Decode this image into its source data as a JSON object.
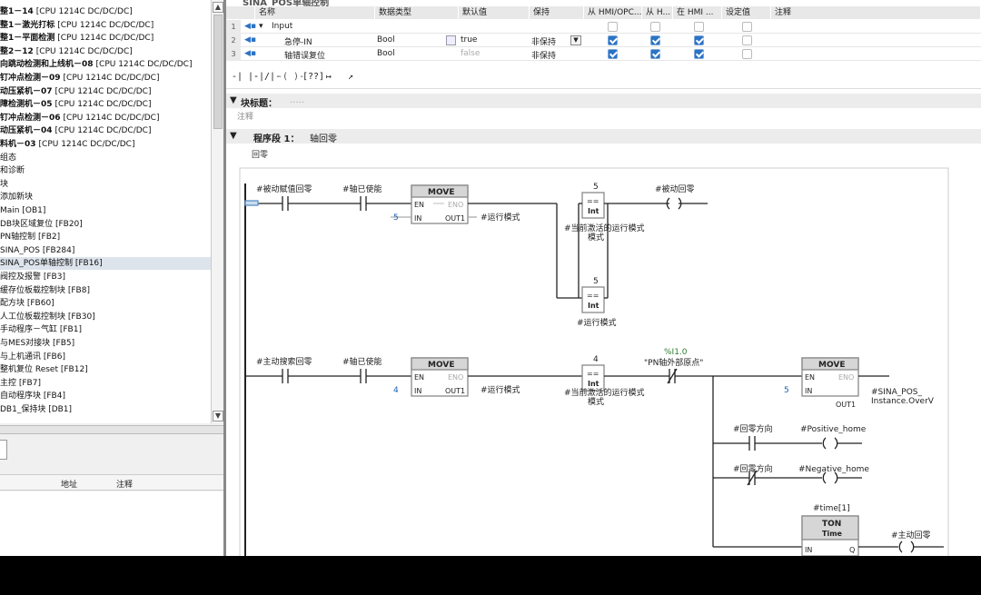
{
  "tree": {
    "items": [
      {
        "name": "整1－14",
        "cpu": "[CPU 1214C DC/DC/DC]"
      },
      {
        "name": "整1－激光打标",
        "cpu": "[CPU 1214C DC/DC/DC]"
      },
      {
        "name": "整1－平面检测",
        "cpu": "[CPU 1214C DC/DC/DC]"
      },
      {
        "name": "整2－12",
        "cpu": "[CPU 1214C DC/DC/DC]"
      },
      {
        "name": "向跳动检测和上线机－08",
        "cpu": "[CPU 1214C DC/DC/DC]"
      },
      {
        "name": "钉冲点检测－09",
        "cpu": "[CPU 1214C DC/DC/DC]"
      },
      {
        "name": "动压紧机－07",
        "cpu": "[CPU 1214C DC/DC/DC]"
      },
      {
        "name": "障检测机－05",
        "cpu": "[CPU 1214C DC/DC/DC]"
      },
      {
        "name": "钉冲点检测－06",
        "cpu": "[CPU 1214C DC/DC/DC]"
      },
      {
        "name": "动压紧机－04",
        "cpu": "[CPU 1214C DC/DC/DC]"
      },
      {
        "name": "料机－03",
        "cpu": "[CPU 1214C DC/DC/DC]"
      }
    ],
    "subitems": [
      "组态",
      "和诊断",
      "块",
      "添加新块",
      "Main [OB1]",
      "DB块区域复位 [FB20]",
      "PN轴控制 [FB2]",
      "SINA_POS [FB284]",
      "SINA_POS单轴控制 [FB16]",
      "阀控及报警 [FB3]",
      "缓存位板载控制块 [FB8]",
      "配方块 [FB60]",
      "人工位板载控制块 [FB30]",
      "手动程序－气缸 [FB1]",
      "与MES对接块 [FB5]",
      "与上机通讯 [FB6]",
      "整机复位 Reset [FB12]",
      "主控 [FB7]",
      "自动程序块 [FB4]",
      "DB1_保持块 [DB1]"
    ]
  },
  "detail": {
    "address": "地址",
    "comment": "注释"
  },
  "interface": {
    "title": "SINA_POS单轴控制",
    "headers": {
      "name": "名称",
      "type": "数据类型",
      "default": "默认值",
      "retain": "保持",
      "hmi_opc": "从 HMI/OPC...",
      "from_h": "从 H...",
      "in_hmi": "在 HMI ...",
      "setpoint": "设定值",
      "comment": "注释"
    },
    "rows": [
      {
        "num": "1",
        "name": "Input",
        "type": "",
        "default": "",
        "retain": ""
      },
      {
        "num": "2",
        "name": "急停-IN",
        "type": "Bool",
        "default": "true",
        "retain": "非保持"
      },
      {
        "num": "3",
        "name": "轴错误复位",
        "type": "Bool",
        "default": "false",
        "retain": "非保持"
      }
    ]
  },
  "toolbar": {
    "items": [
      "-| |-",
      "-|/|-",
      "-( )-",
      "[??]",
      "↦",
      "↗"
    ]
  },
  "block": {
    "title_label": "块标题：",
    "title_comment": "注释"
  },
  "network": {
    "title": "程序段 1：",
    "name": "轴回零",
    "comment": "回零"
  },
  "ladder": {
    "r1": {
      "contact1": "#被动赋值回零",
      "contact2": "#轴已使能",
      "move_label": "MOVE",
      "en": "EN",
      "eno": "ENO",
      "in": "IN",
      "out1": "OUT1",
      "in_val": "5",
      "out_var": "#运行模式",
      "cmp1_val": "5",
      "cmp1_op": "==",
      "cmp1_type": "Int",
      "cmp1_var": "#当前激活的运行模式",
      "cmp2_val": "5",
      "cmp2_op": "==",
      "cmp2_type": "Int",
      "cmp2_var": "#运行模式",
      "coil": "#被动回零"
    },
    "r2": {
      "contact1": "#主动搜索回零",
      "contact2": "#轴已使能",
      "move_label": "MOVE",
      "en": "EN",
      "eno": "ENO",
      "in": "IN",
      "out1": "OUT1",
      "in_val": "4",
      "out_var": "#运行模式",
      "cmp_val": "4",
      "cmp_op": "==",
      "cmp_type": "Int",
      "cmp_var": "#当前激活的运行模式",
      "nc_addr": "%I1.0",
      "nc_name": "\"PN轴外部原点\"",
      "move2_label": "MOVE",
      "move2_in_val": "5",
      "move2_out_var": "#SINA_POS_",
      "move2_out_var2": "Instance.OverV",
      "dir1": "#回零方向",
      "coil_pos": "#Positive_home",
      "dir2": "#回零方向",
      "coil_neg": "#Negative_home",
      "timer_inst": "#time[1]",
      "ton": "TON",
      "ton_type": "Time",
      "ton_in": "IN",
      "ton_q": "Q",
      "coil_active": "#主动回零"
    }
  }
}
